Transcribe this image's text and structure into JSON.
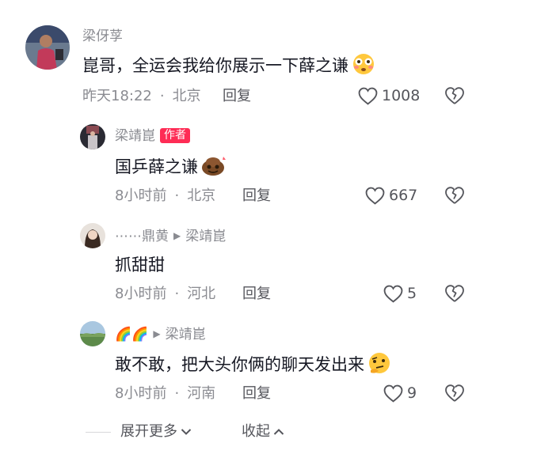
{
  "comments": [
    {
      "username": "梁伢莩",
      "text": "崑哥，全运会我给你展示一下薛之谦",
      "time": "昨天18:22",
      "location": "北京",
      "reply_label": "回复",
      "like_count": "1008"
    },
    {
      "username": "梁靖崑",
      "author_tag": "作者",
      "text": "国乒薛之谦",
      "time": "8小时前",
      "location": "北京",
      "reply_label": "回复",
      "like_count": "667"
    },
    {
      "username": "⋯⋯鼎黄",
      "reply_to": "梁靖崑",
      "text": "抓甜甜",
      "time": "8小时前",
      "location": "河北",
      "reply_label": "回复",
      "like_count": "5"
    },
    {
      "username": "🌈🌈",
      "reply_to": "梁靖崑",
      "text": "敢不敢，把大头你俩的聊天发出来",
      "time": "8小时前",
      "location": "河南",
      "reply_label": "回复",
      "like_count": "9"
    }
  ],
  "footer": {
    "expand_label": "展开更多",
    "collapse_label": "收起"
  },
  "colors": {
    "author_tag": "#fe2c55",
    "muted_text": "#8a8b91"
  }
}
